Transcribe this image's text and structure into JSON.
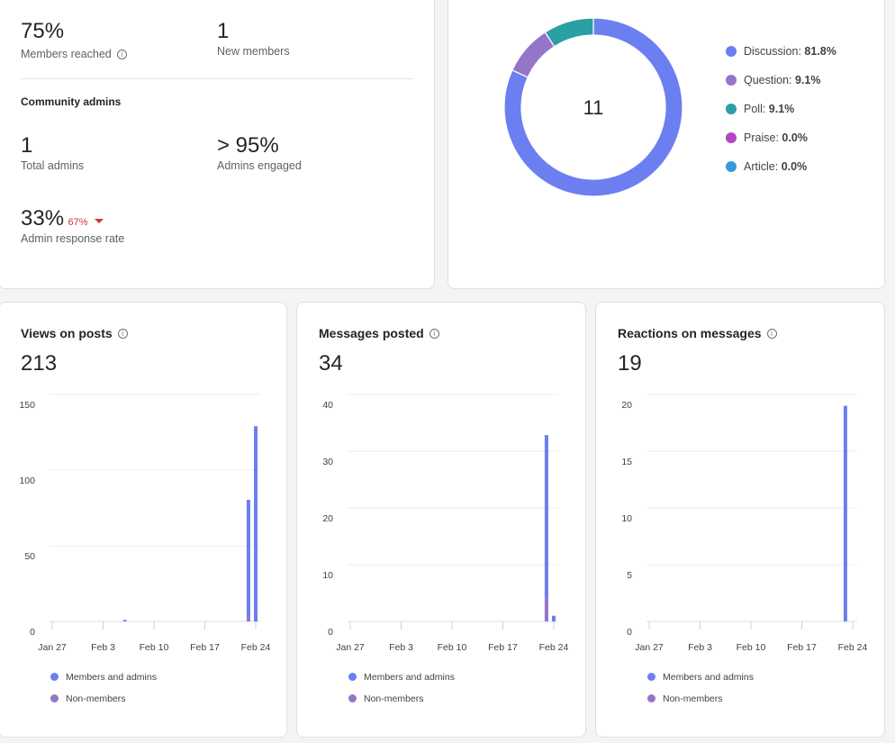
{
  "members": {
    "members_reached": {
      "value": "75%",
      "label": "Members reached"
    },
    "new_members": {
      "value": "1",
      "label": "New members"
    }
  },
  "admins": {
    "heading": "Community admins",
    "total_admins": {
      "value": "1",
      "label": "Total admins"
    },
    "admins_engaged": {
      "value": "> 95%",
      "label": "Admins engaged"
    },
    "response_rate": {
      "value": "33%",
      "change": "67%",
      "change_direction": "down",
      "label": "Admin response rate"
    }
  },
  "colors": {
    "members": "#6b7ff0",
    "non_members": "#9575c7",
    "change_down": "#d13438"
  },
  "chart_data": [
    {
      "type": "pie",
      "center_label": "11",
      "categories": [
        "Discussion",
        "Question",
        "Poll",
        "Praise",
        "Article"
      ],
      "values": [
        81.8,
        9.1,
        9.1,
        0.0,
        0.0
      ],
      "value_labels": [
        "81.8%",
        "9.1%",
        "9.1%",
        "0.0%",
        "0.0%"
      ],
      "colors": [
        "#6b7ff0",
        "#9575c7",
        "#2aa0a4",
        "#b146c2",
        "#3a96dd"
      ],
      "legend": "right"
    },
    {
      "type": "bar",
      "title": "Views on posts",
      "total": "213",
      "x_ticks": [
        "Jan 27",
        "Feb 3",
        "Feb 10",
        "Feb 17",
        "Feb 24"
      ],
      "y_ticks": [
        "0",
        "50",
        "100",
        "150"
      ],
      "ylim": [
        0,
        150
      ],
      "grid": true,
      "stacked": true,
      "x": [
        "Feb 6",
        "Feb 23",
        "Feb 24"
      ],
      "series": [
        {
          "name": "Members and admins",
          "values": [
            1,
            79,
            129
          ]
        },
        {
          "name": "Non-members",
          "values": [
            0,
            2,
            0
          ]
        }
      ]
    },
    {
      "type": "bar",
      "title": "Messages posted",
      "total": "34",
      "x_ticks": [
        "Jan 27",
        "Feb 3",
        "Feb 10",
        "Feb 17",
        "Feb 24"
      ],
      "y_ticks": [
        "0",
        "10",
        "20",
        "30",
        "40"
      ],
      "ylim": [
        0,
        40
      ],
      "grid": true,
      "stacked": true,
      "x": [
        "Feb 23",
        "Feb 24"
      ],
      "series": [
        {
          "name": "Members and admins",
          "values": [
            29,
            1
          ]
        },
        {
          "name": "Non-members",
          "values": [
            4,
            0
          ]
        }
      ]
    },
    {
      "type": "bar",
      "title": "Reactions on messages",
      "total": "19",
      "x_ticks": [
        "Jan 27",
        "Feb 3",
        "Feb 10",
        "Feb 17",
        "Feb 24"
      ],
      "y_ticks": [
        "0",
        "5",
        "10",
        "15",
        "20"
      ],
      "ylim": [
        0,
        20
      ],
      "grid": true,
      "stacked": true,
      "x": [
        "Feb 23"
      ],
      "series": [
        {
          "name": "Members and admins",
          "values": [
            19
          ]
        },
        {
          "name": "Non-members",
          "values": [
            0
          ]
        }
      ]
    }
  ]
}
